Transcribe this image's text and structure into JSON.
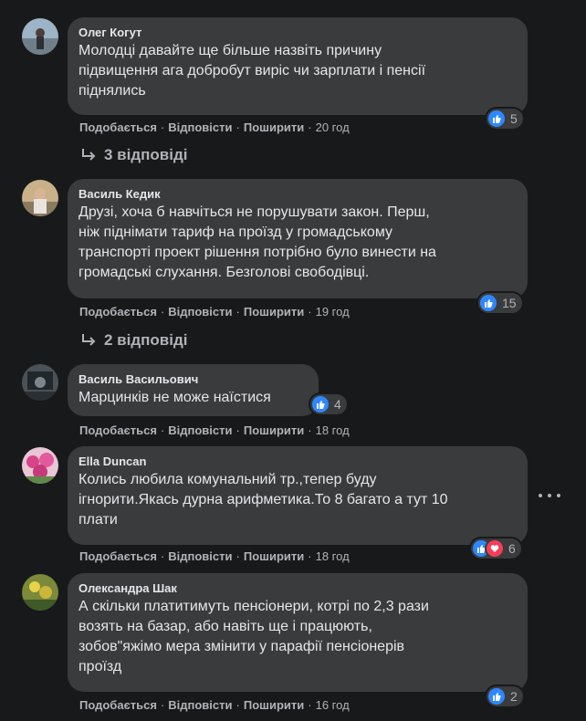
{
  "actions": {
    "like": "Подобається",
    "reply": "Відповісти",
    "share": "Поширити"
  },
  "comments": [
    {
      "author": "Олег Когут",
      "text": "Молодці давайте ще більше назвіть причину\nпідвищення ага добробут виріс чи зарплати і пенсії\nпіднялись",
      "reactions": "5",
      "time": "20 год",
      "replies": "3 відповіді"
    },
    {
      "author": "Василь Кедик",
      "text": "Друзі, хоча б навчіться не порушувати закон. Перш,\nніж піднімати тариф на проїзд у громадському\nтранспорті проект рішення потрібно було винести на\nгромадські слухання. Безголові свободівці.",
      "reactions": "15",
      "time": "19 год",
      "replies": "2 відповіді"
    },
    {
      "author": "Василь Васильович",
      "text": "Марцинків не може наїстися",
      "reactions": "4",
      "time": "18 год"
    },
    {
      "author": "Ella Duncan",
      "text": "Колись любила комунальний тр.,тепер буду\nігнорити.Якась дурна арифметика.То 8 багато а тут 10\nплати",
      "reactions": "6",
      "time": "18 год"
    },
    {
      "author": "Олександра Шак",
      "text": "А скільки платитимуть пенсіонери, котрі по 2,3 рази\nвозять на базар, або навіть ще і працюють,\nзобов\"яжімо мера змінити у парафії пенсіонерів\nпроїзд",
      "reactions": "2",
      "time": "16 год"
    }
  ],
  "colors": {
    "like": "#2d88ff",
    "love": "#f33e58",
    "bubble": "#3a3b3c",
    "background": "#18191a"
  },
  "icons": [
    "like-icon",
    "love-icon",
    "reply-arrow-icon",
    "more-options-icon"
  ]
}
